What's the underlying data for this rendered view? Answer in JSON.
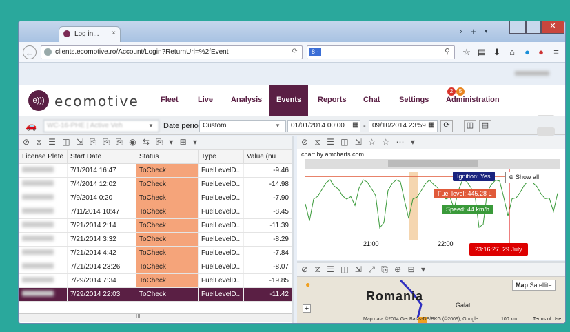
{
  "browser": {
    "tab_title": "Log in...",
    "tab_close": "×",
    "url": "clients.ecomotive.ro/Account/Login?ReturnUrl=%2fEvent",
    "search_engine": "8 -",
    "user_blurred": "Alba Vasile"
  },
  "header": {
    "logo_text": "ecomotive",
    "badges": [
      "2",
      "5"
    ],
    "menu": [
      {
        "label": "Fleet"
      },
      {
        "label": "Live"
      },
      {
        "label": "Analysis"
      },
      {
        "label": "Events",
        "active": true
      },
      {
        "label": "Reports"
      },
      {
        "label": "Chat"
      },
      {
        "label": "Settings"
      },
      {
        "label": "Administration"
      }
    ]
  },
  "toolbar": {
    "vehicle_value": "WC-16-PHE | Active Veh",
    "date_period_label": "Date period",
    "date_period_value": "Custom",
    "date_from": "01/01/2014 00:00",
    "date_sep": "-",
    "date_to": "09/10/2014 23:59"
  },
  "grid": {
    "columns": [
      "License Plate",
      "Start Date",
      "Status",
      "Type",
      "Value (nu"
    ],
    "rows": [
      {
        "plate": "WC-16-PHE",
        "date": "7/1/2014 16:47",
        "status": "ToCheck",
        "type": "FuelLevelD...",
        "value": "-9.46"
      },
      {
        "plate": "WC-16-PHE",
        "date": "7/4/2014 12:02",
        "status": "ToCheck",
        "type": "FuelLevelD...",
        "value": "-14.98"
      },
      {
        "plate": "WC-16-PHE",
        "date": "7/9/2014 0:20",
        "status": "ToCheck",
        "type": "FuelLevelD...",
        "value": "-7.90"
      },
      {
        "plate": "WC-16-PHE",
        "date": "7/11/2014 10:47",
        "status": "ToCheck",
        "type": "FuelLevelD...",
        "value": "-8.45"
      },
      {
        "plate": "WC-16-PHE",
        "date": "7/21/2014 2:14",
        "status": "ToCheck",
        "type": "FuelLevelD...",
        "value": "-11.39"
      },
      {
        "plate": "WC-16-PHE",
        "date": "7/21/2014 3:32",
        "status": "ToCheck",
        "type": "FuelLevelD...",
        "value": "-8.29"
      },
      {
        "plate": "WC-16-PHE",
        "date": "7/21/2014 4:42",
        "status": "ToCheck",
        "type": "FuelLevelD...",
        "value": "-7.84"
      },
      {
        "plate": "WC-16-PHE",
        "date": "7/21/2014 23:26",
        "status": "ToCheck",
        "type": "FuelLevelD...",
        "value": "-8.07"
      },
      {
        "plate": "WC-16-PHE",
        "date": "7/29/2014 7:34",
        "status": "ToCheck",
        "type": "FuelLevelD...",
        "value": "-19.85"
      },
      {
        "plate": "WC-16-PHE",
        "date": "7/29/2014 22:03",
        "status": "ToCheck",
        "type": "FuelLevelD...",
        "value": "-11.42",
        "selected": true
      }
    ],
    "scroll_mark": "III"
  },
  "chart": {
    "credit": "chart by amcharts.com",
    "show_all": "Show all",
    "tick1": "21:00",
    "tick2": "22:00",
    "cursor_label": "23:16:27, 29 July",
    "tooltip_ignition": "Ignition: Yes",
    "tooltip_fuel": "Fuel level: 445.28 L",
    "tooltip_speed": "Speed: 44 km/h",
    "colors": {
      "fuel": "#e05a3a",
      "speed": "#3a9a3a",
      "ignition": "#1a237e",
      "highlight": "#f5d6b0"
    }
  },
  "map": {
    "country": "Romania",
    "city": "Galati",
    "btn_map": "Map",
    "btn_satellite": "Satellite",
    "attribution": "Map data ©2014 GeoBasis-DE/BKG (©2009), Google",
    "scale": "100 km",
    "terms": "Terms of Use"
  },
  "accent": "#5a1f44",
  "status_color": "#f5a47a"
}
